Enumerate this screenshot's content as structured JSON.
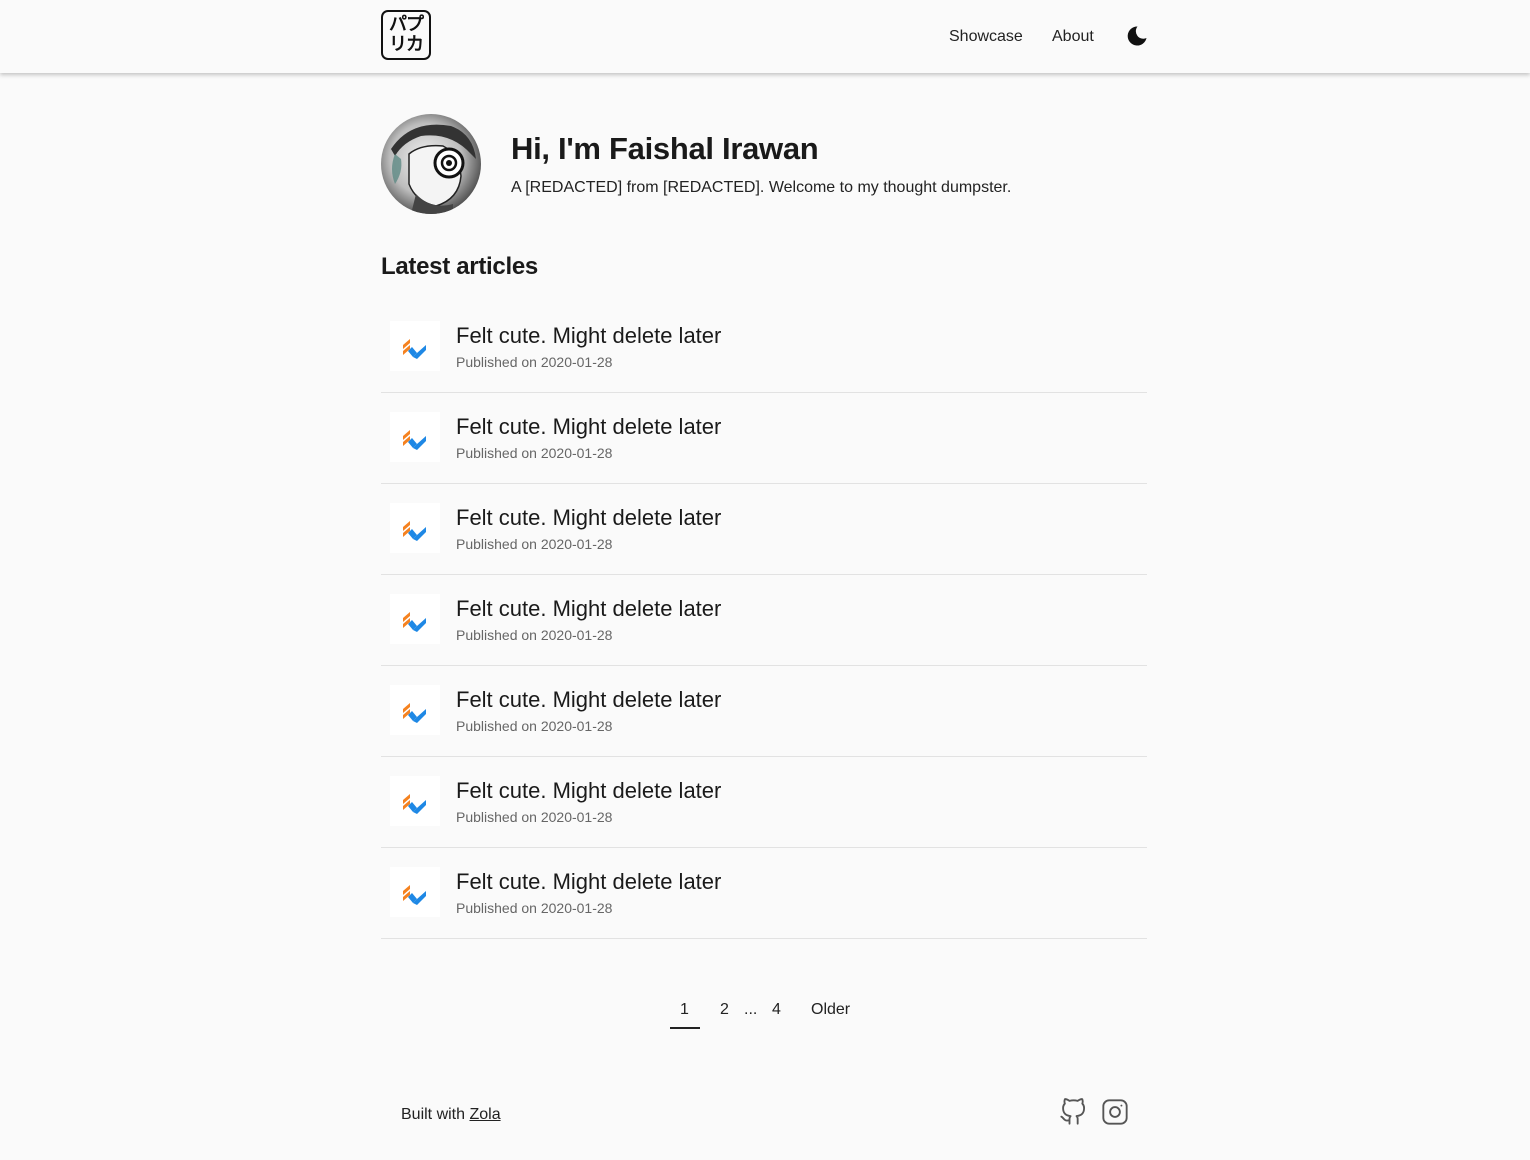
{
  "header": {
    "logo_line1": "パプ",
    "logo_line2": "リカ",
    "nav": {
      "showcase": "Showcase",
      "about": "About"
    },
    "theme_toggle_icon": "moon-icon"
  },
  "intro": {
    "title": "Hi, I'm Faishal Irawan",
    "subtitle": "A [REDACTED] from [REDACTED]. Welcome to my thought dumpster."
  },
  "articles_section": {
    "title": "Latest articles",
    "items": [
      {
        "title": "Felt cute. Might delete later",
        "meta": "Published on 2020-01-28"
      },
      {
        "title": "Felt cute. Might delete later",
        "meta": "Published on 2020-01-28"
      },
      {
        "title": "Felt cute. Might delete later",
        "meta": "Published on 2020-01-28"
      },
      {
        "title": "Felt cute. Might delete later",
        "meta": "Published on 2020-01-28"
      },
      {
        "title": "Felt cute. Might delete later",
        "meta": "Published on 2020-01-28"
      },
      {
        "title": "Felt cute. Might delete later",
        "meta": "Published on 2020-01-28"
      },
      {
        "title": "Felt cute. Might delete later",
        "meta": "Published on 2020-01-28"
      }
    ]
  },
  "pagination": {
    "current": "1",
    "page2": "2",
    "ellipsis": "...",
    "last": "4",
    "older": "Older"
  },
  "footer": {
    "built_with": "Built with ",
    "zola_link": "Zola",
    "social_icons": [
      "github-icon",
      "instagram-icon"
    ]
  },
  "colors": {
    "background": "#fafafa",
    "text": "#222222",
    "thumb_orange": "#f58220",
    "thumb_blue": "#1e88e5"
  }
}
